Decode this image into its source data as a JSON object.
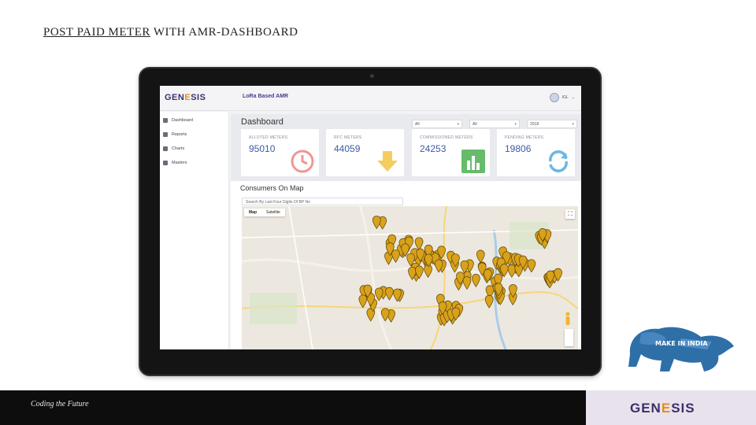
{
  "slide": {
    "title_part1": "POST PAID METER",
    "title_part2": " WITH AMR-DASHBOARD",
    "tagline": "Coding the Future"
  },
  "brand": {
    "logo_part1": "GEN",
    "logo_accent": "E",
    "logo_part2": "SIS",
    "make_in_india": "MAKE IN INDIA"
  },
  "app": {
    "title": "LoRa Based AMR",
    "user_name": "IGL"
  },
  "sidebar": {
    "items": [
      {
        "label": "Dashboard",
        "icon": "home-icon"
      },
      {
        "label": "Reports",
        "icon": "document-icon"
      },
      {
        "label": "Charts",
        "icon": "chart-icon"
      },
      {
        "label": "Masters",
        "icon": "grid-icon"
      }
    ]
  },
  "dashboard": {
    "title": "Dashboard",
    "filters": [
      "All",
      "All",
      "2018"
    ],
    "cards": [
      {
        "label": "ALLOTED METERS",
        "value": "95010",
        "icon": "clock-icon",
        "color": "#e84f4f"
      },
      {
        "label": "RFC METERS",
        "value": "44059",
        "icon": "down-arrow-icon",
        "color": "#f2c037"
      },
      {
        "label": "COMMISSIONED METERS",
        "value": "24253",
        "icon": "bar-chart-icon",
        "color": "#4caf50"
      },
      {
        "label": "PENDING METERS",
        "value": "19806",
        "icon": "refresh-icon",
        "color": "#6bb7e3"
      }
    ]
  },
  "map": {
    "title": "Consumers On Map",
    "search_placeholder": "Search By Last Four Digits Of BP No",
    "tabs": [
      "Map",
      "Satellite"
    ]
  },
  "colors": {
    "brand_purple": "#3b2f6b",
    "brand_orange": "#e88a1a",
    "marker": "#d9a21b"
  }
}
